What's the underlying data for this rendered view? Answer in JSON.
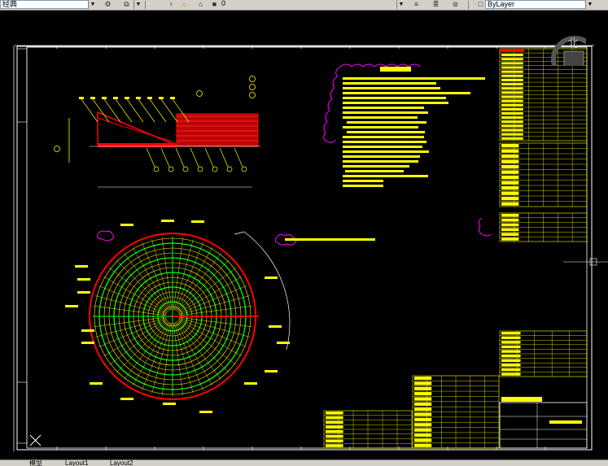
{
  "toolbar": {
    "style_value": "经典",
    "layer_value": "0",
    "linetype_value": "ByLayer"
  },
  "tabs": {
    "model": "模型",
    "layout1": "Layout1",
    "layout2": "Layout2"
  },
  "viewcube": {
    "north_label": "北"
  },
  "colors": {
    "background": "#000000",
    "annotation": "#ffff00",
    "hatch": "#00ff00",
    "wall": "#ff0000",
    "revision_cloud": "#ff00ff",
    "frame": "#ffffff"
  }
}
